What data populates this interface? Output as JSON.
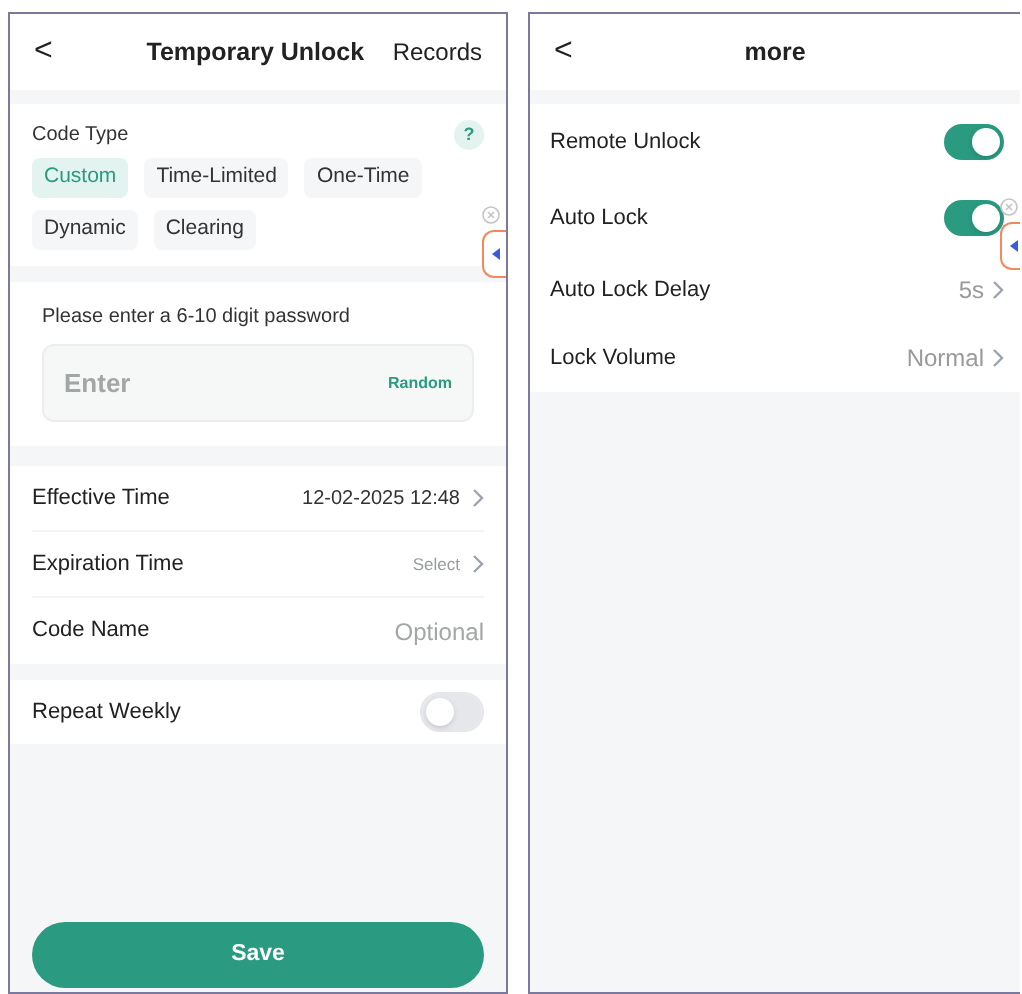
{
  "temporary_unlock": {
    "header": {
      "back": "<",
      "title": "Temporary Unlock",
      "action": "Records"
    },
    "code_type": {
      "label": "Code Type",
      "help": "?",
      "options": [
        {
          "label": "Custom",
          "selected": true
        },
        {
          "label": "Time-Limited",
          "selected": false
        },
        {
          "label": "One-Time",
          "selected": false
        },
        {
          "label": "Dynamic",
          "selected": false
        },
        {
          "label": "Clearing",
          "selected": false
        }
      ]
    },
    "password": {
      "prompt": "Please enter a 6-10 digit password",
      "placeholder": "Enter",
      "random": "Random"
    },
    "fields": [
      {
        "kind": "link",
        "label": "Effective Time",
        "value": "12-02-2025 12:48"
      },
      {
        "kind": "link",
        "label": "Expiration Time",
        "placeholder": "Select"
      },
      {
        "kind": "input",
        "label": "Code Name",
        "placeholder": "Optional"
      }
    ],
    "repeat_weekly": {
      "label": "Repeat Weekly",
      "on": false
    },
    "save": "Save"
  },
  "more": {
    "header": {
      "back": "<",
      "title": "more"
    },
    "rows": [
      {
        "kind": "toggle",
        "label": "Remote Unlock",
        "on": true
      },
      {
        "kind": "toggle",
        "label": "Auto Lock",
        "on": true
      },
      {
        "kind": "link",
        "label": "Auto Lock Delay",
        "value": "5s"
      },
      {
        "kind": "link",
        "label": "Lock Volume",
        "value": "Normal"
      }
    ]
  }
}
